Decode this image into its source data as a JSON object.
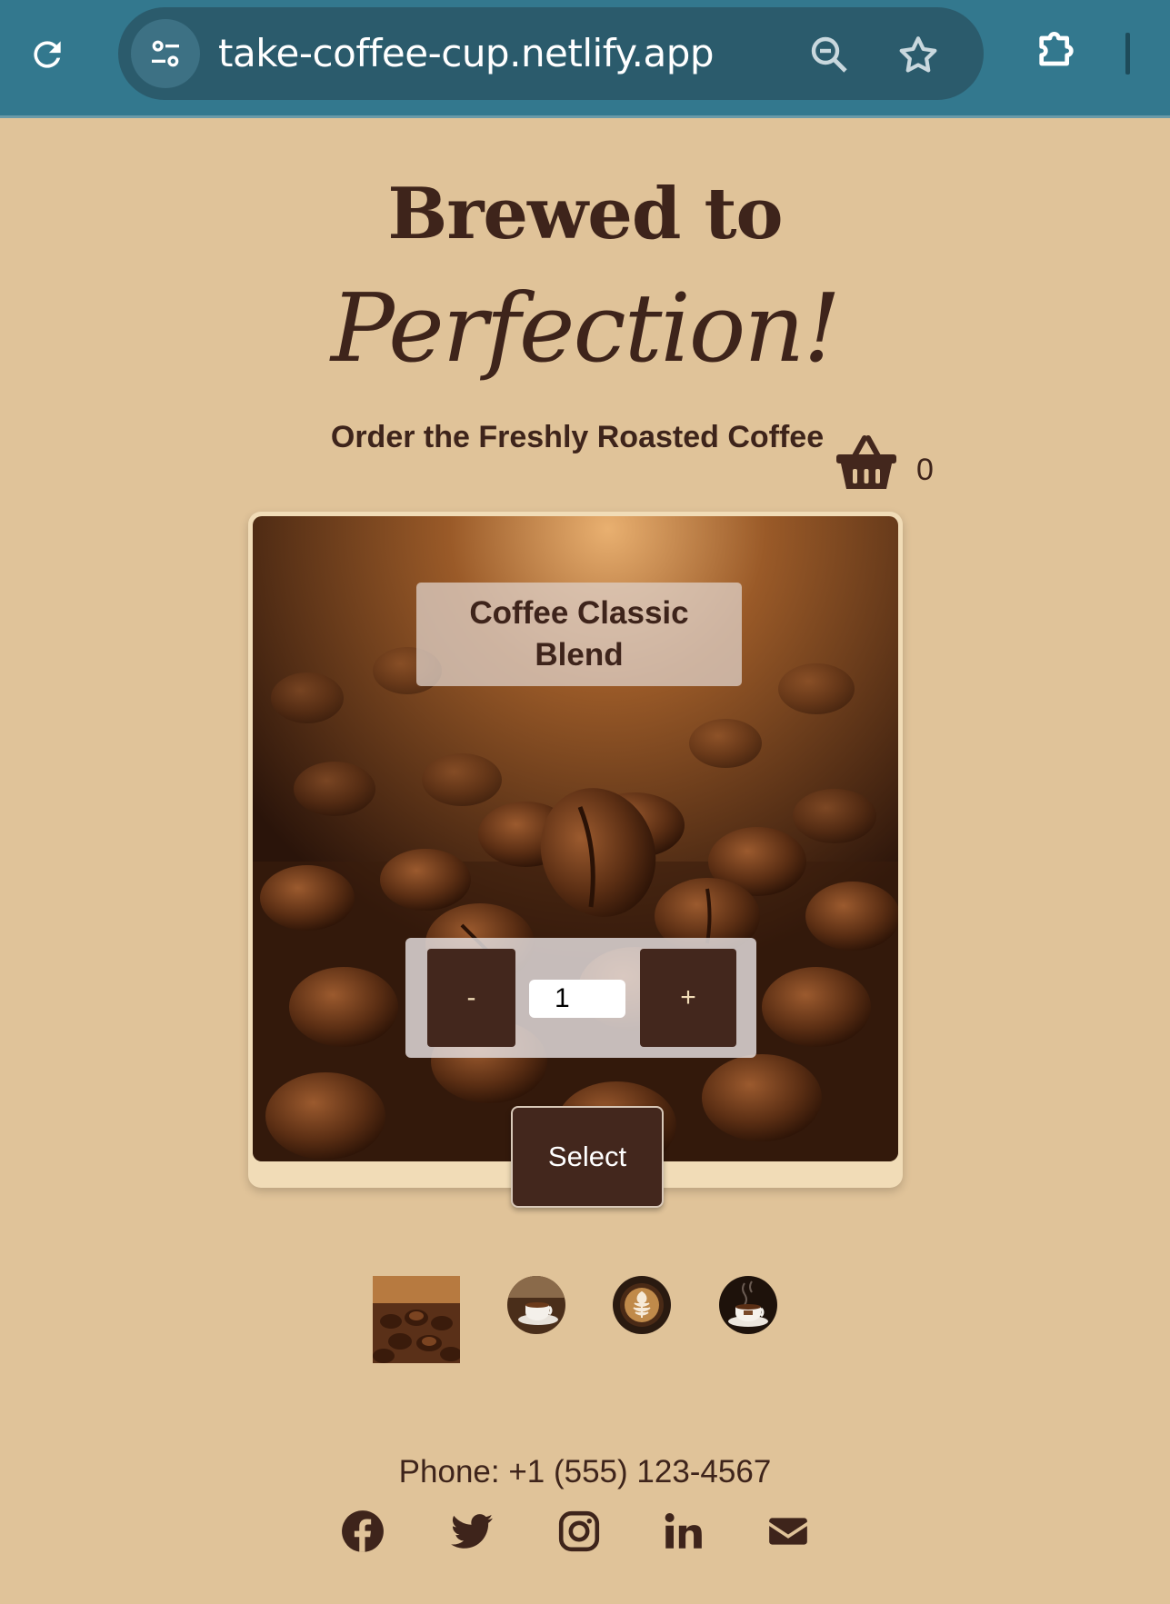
{
  "browser": {
    "url": "take-coffee-cup.netlify.app",
    "icons": [
      "reload-icon",
      "site-settings-icon",
      "zoom-out-icon",
      "bookmark-star-icon",
      "extensions-icon"
    ]
  },
  "hero": {
    "title_line1": "Brewed to",
    "title_line2": "Perfection!",
    "subtitle": "Order the Freshly Roasted Coffee"
  },
  "cart": {
    "icon": "basket-icon",
    "count": "0"
  },
  "product": {
    "name": "Coffee Classic Blend",
    "quantity": "1",
    "decrement_label": "-",
    "increment_label": "+",
    "select_label": "Select"
  },
  "thumbnails": [
    {
      "name": "coffee-beans-thumbnail",
      "selected": true
    },
    {
      "name": "coffee-cup-thumbnail",
      "selected": false
    },
    {
      "name": "latte-art-thumbnail",
      "selected": false
    },
    {
      "name": "steaming-cup-thumbnail",
      "selected": false
    }
  ],
  "footer": {
    "phone": "Phone: +1 (555) 123-4567",
    "social": [
      "facebook-icon",
      "twitter-icon",
      "instagram-icon",
      "linkedin-icon",
      "mail-icon"
    ]
  },
  "colors": {
    "page_bg": "#e0c399",
    "brown": "#43271d",
    "browser_bar": "#33788e",
    "card_bg": "#f1dcb7"
  }
}
